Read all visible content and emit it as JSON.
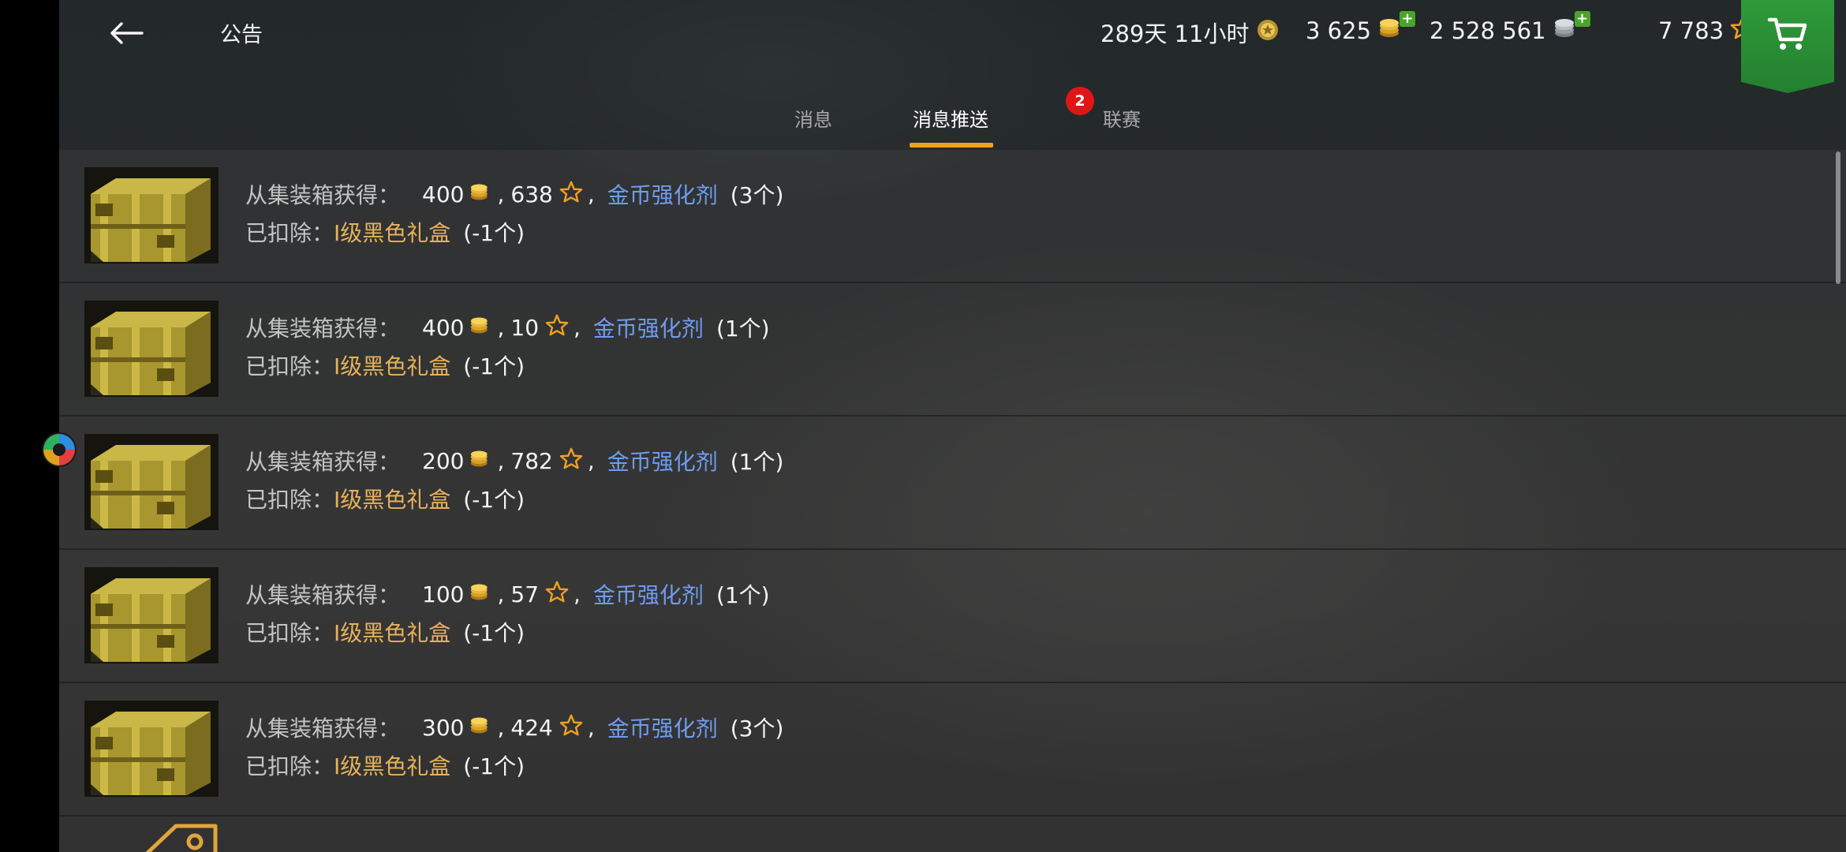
{
  "header": {
    "title": "公告",
    "timer": "289天 11小时",
    "coins": "3 625",
    "silver": "2 528 561",
    "stars": "7 783"
  },
  "tabs": [
    {
      "label": "消息",
      "active": false
    },
    {
      "label": "消息推送",
      "active": true,
      "badge": "2"
    },
    {
      "label": "联赛",
      "active": false
    }
  ],
  "messages": [
    {
      "gain_prefix": "从集装箱获得：",
      "coins": "400",
      "stars": "638",
      "item": "金币强化剂",
      "item_count": "(3个)",
      "deduct_prefix": "已扣除：",
      "deduct_item": "Ⅰ级黑色礼盒",
      "deduct_count": "(-1个)"
    },
    {
      "gain_prefix": "从集装箱获得：",
      "coins": "400",
      "stars": "10",
      "item": "金币强化剂",
      "item_count": "(1个)",
      "deduct_prefix": "已扣除：",
      "deduct_item": "Ⅰ级黑色礼盒",
      "deduct_count": "(-1个)"
    },
    {
      "gain_prefix": "从集装箱获得：",
      "coins": "200",
      "stars": "782",
      "item": "金币强化剂",
      "item_count": "(1个)",
      "deduct_prefix": "已扣除：",
      "deduct_item": "Ⅰ级黑色礼盒",
      "deduct_count": "(-1个)"
    },
    {
      "gain_prefix": "从集装箱获得：",
      "coins": "100",
      "stars": "57",
      "item": "金币强化剂",
      "item_count": "(1个)",
      "deduct_prefix": "已扣除：",
      "deduct_item": "Ⅰ级黑色礼盒",
      "deduct_count": "(-1个)"
    },
    {
      "gain_prefix": "从集装箱获得：",
      "coins": "300",
      "stars": "424",
      "item": "金币强化剂",
      "item_count": "(3个)",
      "deduct_prefix": "已扣除：",
      "deduct_item": "Ⅰ级黑色礼盒",
      "deduct_count": "(-1个)"
    }
  ],
  "colors": {
    "accent_tab": "#f0a020",
    "badge": "#e01616",
    "item_link": "#6f9cf0",
    "deduct_item": "#e7b25a",
    "shop": "#2f9a3a"
  },
  "icons": [
    "back-arrow-icon",
    "premium-laurel-icon",
    "gold-coins-icon",
    "silver-coins-icon",
    "star-icon",
    "shopping-cart-icon",
    "container-icon"
  ]
}
